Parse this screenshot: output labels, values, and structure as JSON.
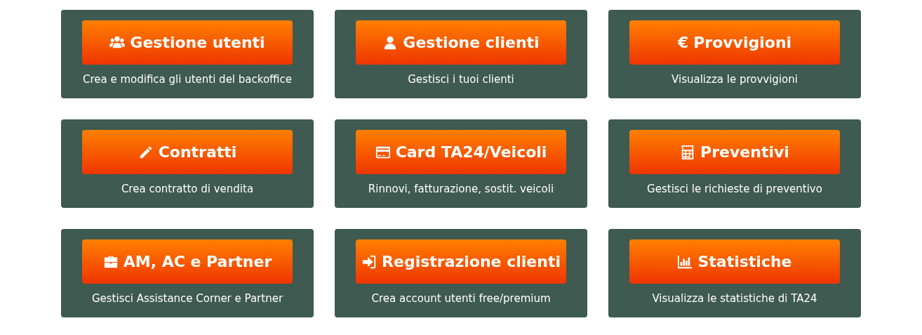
{
  "cards": [
    {
      "button": "Gestione utenti",
      "icon": {
        "kind": "users"
      },
      "description": "Crea e modifica gli utenti del backoffice"
    },
    {
      "button": "Gestione clienti",
      "icon": {
        "kind": "user"
      },
      "description": "Gestisci i tuoi clienti"
    },
    {
      "button": "Provvigioni",
      "icon": {
        "kind": "glyph",
        "text": "€"
      },
      "description": "Visualizza le provvigioni"
    },
    {
      "button": "Contratti",
      "icon": {
        "kind": "pencil"
      },
      "description": "Crea contratto di vendita"
    },
    {
      "button": "Card TA24/Veicoli",
      "icon": {
        "kind": "card"
      },
      "description": "Rinnovi, fatturazione, sostit. veicoli"
    },
    {
      "button": "Preventivi",
      "icon": {
        "kind": "calculator"
      },
      "description": "Gestisci le richieste di preventivo"
    },
    {
      "button": "AM, AC e Partner",
      "icon": {
        "kind": "briefcase"
      },
      "description": "Gestisci Assistance Corner e Partner"
    },
    {
      "button": "Registrazione clienti",
      "icon": {
        "kind": "signin"
      },
      "description": "Crea account utenti free/premium"
    },
    {
      "button": "Statistiche",
      "icon": {
        "kind": "chart"
      },
      "description": "Visualizza le statistiche di TA24"
    }
  ]
}
